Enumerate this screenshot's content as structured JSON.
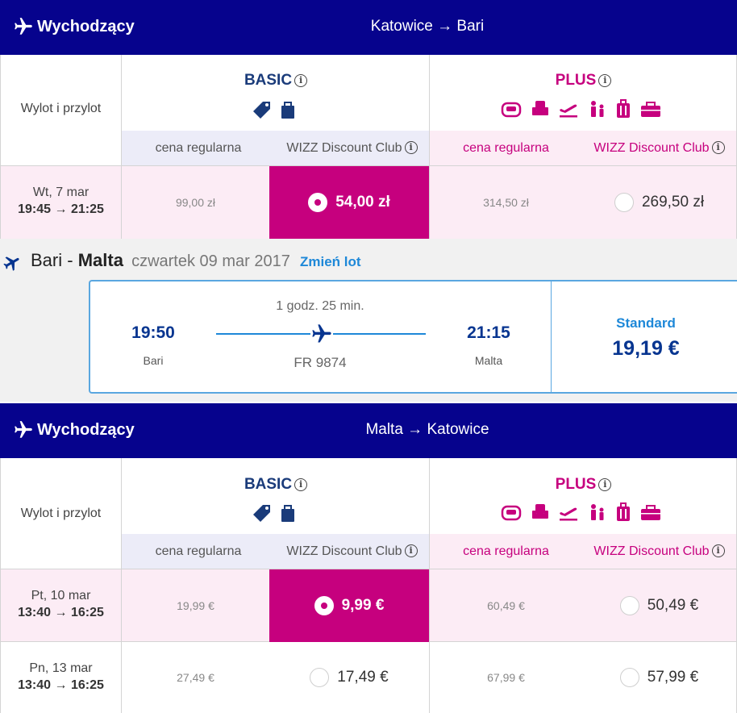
{
  "colors": {
    "header_bg": "#06038d",
    "wizz_pink": "#c6007e",
    "ryanair_blue": "#073590",
    "link_blue": "#1e88d8"
  },
  "outbound1": {
    "header": {
      "direction": "Wychodzący",
      "route": "Katowice → Bari"
    },
    "col_label": "Wylot i przylot",
    "basic": {
      "title": "BASIC",
      "icons": [
        "tag-icon",
        "bag-icon"
      ],
      "regular": "cena regularna",
      "club": "WIZZ Discount Club"
    },
    "plus": {
      "title": "PLUS",
      "icons": [
        "seat-icon",
        "armchair-icon",
        "departure-icon",
        "family-icon",
        "luggage-icon",
        "bag-icon"
      ],
      "regular": "cena regularna",
      "club": "WIZZ Discount Club"
    },
    "rows": [
      {
        "date": "Wt, 7 mar",
        "times": "19:45 → 21:25",
        "basic_regular": "99,00 zł",
        "basic_club": "54,00 zł",
        "plus_regular": "314,50 zł",
        "plus_club": "269,50 zł"
      }
    ]
  },
  "ryanair": {
    "from": "Bari",
    "sep": "-",
    "to": "Malta",
    "date": "czwartek 09 mar 2017",
    "change_link": "Zmień lot",
    "duration": "1 godz. 25 min.",
    "dep_time": "19:50",
    "dep_city": "Bari",
    "arr_time": "21:15",
    "arr_city": "Malta",
    "flight_no": "FR 9874",
    "fare_name": "Standard",
    "fare_price": "19,19 €"
  },
  "outbound2": {
    "header": {
      "direction": "Wychodzący",
      "route": "Malta → Katowice"
    },
    "col_label": "Wylot i przylot",
    "basic": {
      "title": "BASIC",
      "regular": "cena regularna",
      "club": "WIZZ Discount Club"
    },
    "plus": {
      "title": "PLUS",
      "regular": "cena regularna",
      "club": "WIZZ Discount Club"
    },
    "rows": [
      {
        "date": "Pt, 10 mar",
        "times": "13:40 → 16:25",
        "basic_regular": "19,99 €",
        "basic_club": "9,99 €",
        "plus_regular": "60,49 €",
        "plus_club": "50,49 €"
      },
      {
        "date": "Pn, 13 mar",
        "times": "13:40 → 16:25",
        "basic_regular": "27,49 €",
        "basic_club": "17,49 €",
        "plus_regular": "67,99 €",
        "plus_club": "57,99 €"
      }
    ]
  }
}
